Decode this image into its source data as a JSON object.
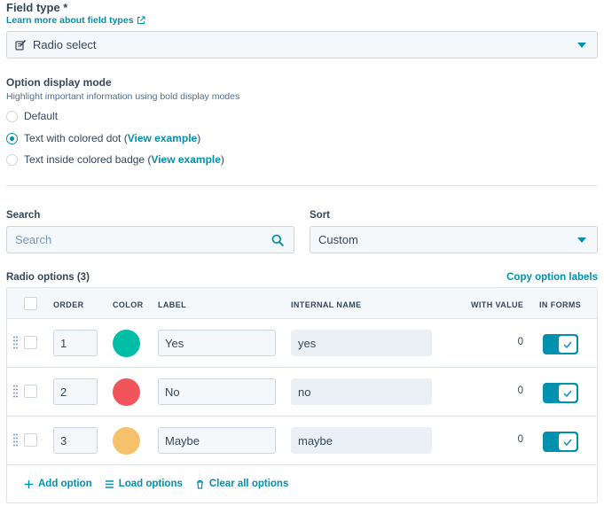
{
  "field_type": {
    "title": "Field type *",
    "learn_link": "Learn more about field types",
    "selected": "Radio select"
  },
  "display_mode": {
    "title": "Option display mode",
    "subtitle": "Highlight important information using bold display modes",
    "options": [
      {
        "label": "Default",
        "link": "",
        "suffix": "",
        "checked": false
      },
      {
        "label": "Text with colored dot (",
        "link": "View example",
        "suffix": ")",
        "checked": true
      },
      {
        "label": "Text inside colored badge (",
        "link": "View example",
        "suffix": ")",
        "checked": false
      }
    ]
  },
  "search": {
    "label": "Search",
    "placeholder": "Search"
  },
  "sort": {
    "label": "Sort",
    "selected": "Custom"
  },
  "options_table": {
    "title": "Radio options (3)",
    "copy_link": "Copy option labels",
    "headers": {
      "order": "ORDER",
      "color": "COLOR",
      "label": "LABEL",
      "internal_name": "INTERNAL NAME",
      "with_value": "WITH VALUE",
      "in_forms": "IN FORMS"
    },
    "rows": [
      {
        "order": "1",
        "color": "#00bda5",
        "label": "Yes",
        "internal_name": "yes",
        "with_value": "0",
        "in_forms": true
      },
      {
        "order": "2",
        "color": "#f2545b",
        "label": "No",
        "internal_name": "no",
        "with_value": "0",
        "in_forms": true
      },
      {
        "order": "3",
        "color": "#f5c26b",
        "label": "Maybe",
        "internal_name": "maybe",
        "with_value": "0",
        "in_forms": true
      }
    ],
    "actions": {
      "add": "Add option",
      "load": "Load options",
      "clear": "Clear all options"
    }
  },
  "colors": {
    "accent": "#0091ae",
    "text": "#33475b"
  }
}
